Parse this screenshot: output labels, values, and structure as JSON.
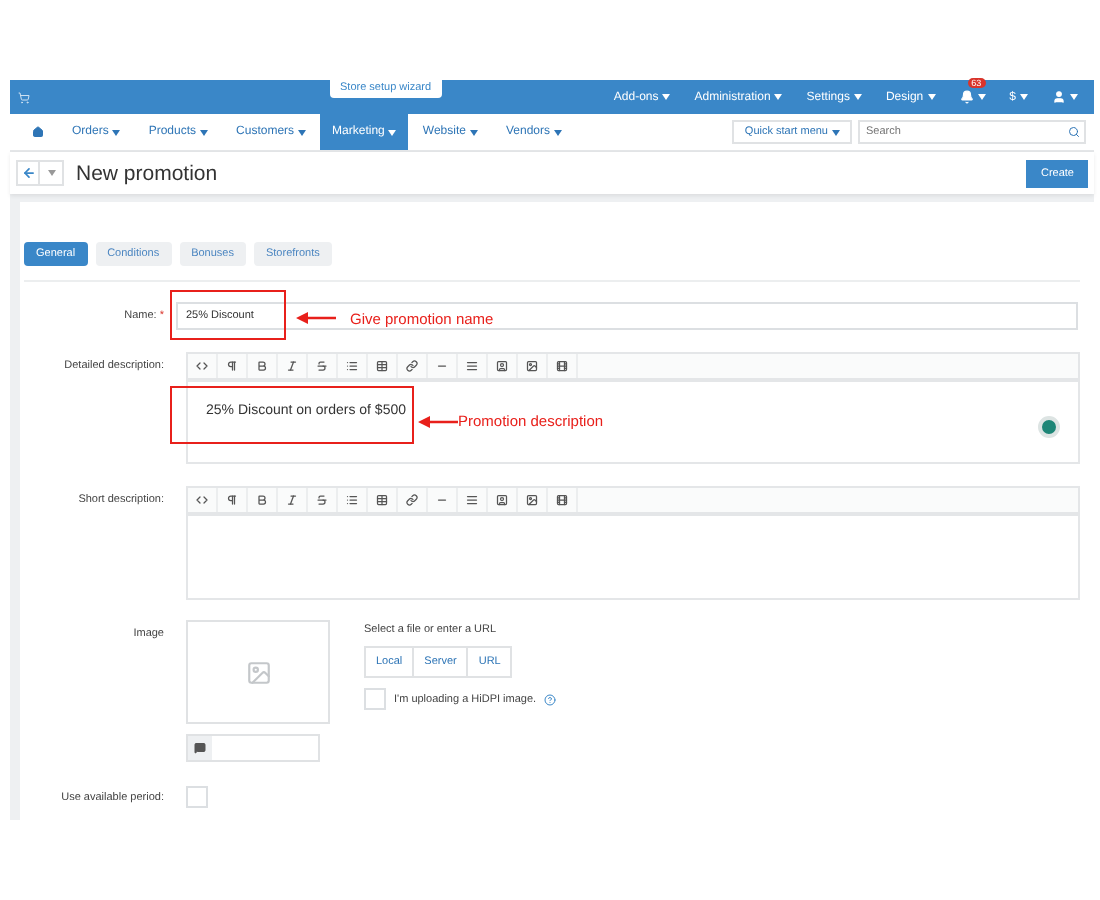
{
  "top_bar": {
    "wizard_tab": "Store setup wizard",
    "menu": [
      {
        "label": "Add-ons"
      },
      {
        "label": "Administration"
      },
      {
        "label": "Settings"
      },
      {
        "label": "Design"
      }
    ],
    "notifications_badge": "63",
    "currency": "$"
  },
  "nav": {
    "items": [
      {
        "label": "Orders",
        "selected": false
      },
      {
        "label": "Products",
        "selected": false
      },
      {
        "label": "Customers",
        "selected": false
      },
      {
        "label": "Marketing",
        "selected": true
      },
      {
        "label": "Website",
        "selected": false
      },
      {
        "label": "Vendors",
        "selected": false
      }
    ],
    "quick_start": "Quick start menu",
    "search": {
      "placeholder": "Search"
    }
  },
  "header": {
    "title": "New promotion",
    "create_button": "Create"
  },
  "tabs": [
    {
      "label": "General",
      "selected": true
    },
    {
      "label": "Conditions",
      "selected": false
    },
    {
      "label": "Bonuses",
      "selected": false
    },
    {
      "label": "Storefronts",
      "selected": false
    }
  ],
  "form": {
    "name": {
      "label": "Name:",
      "required_mark": "*",
      "value": "25% Discount"
    },
    "detailed_description": {
      "label": "Detailed description:",
      "content": "25% Discount on orders of $500"
    },
    "short_description": {
      "label": "Short description:"
    },
    "image": {
      "label": "Image",
      "hint": "Select a file or enter a URL",
      "sources": [
        "Local",
        "Server",
        "URL"
      ],
      "hidpi_label": "I'm uploading a HiDPI image.",
      "hidpi_checked": false
    },
    "use_available_period": {
      "label": "Use available period:",
      "checked": false
    }
  },
  "annotations": [
    {
      "text": "Give promotion name"
    },
    {
      "text": "Promotion description"
    }
  ]
}
